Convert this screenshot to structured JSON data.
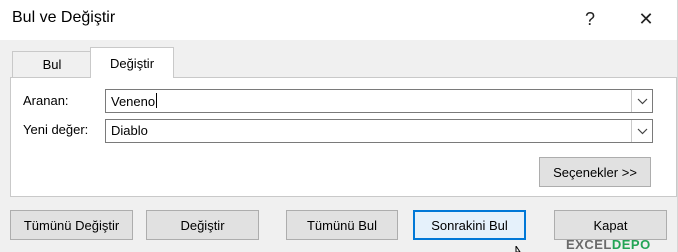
{
  "window": {
    "title": "Bul ve Değiştir",
    "help_glyph": "?",
    "close_glyph": "✕"
  },
  "tabs": [
    {
      "label": "Bul",
      "active": false
    },
    {
      "label": "Değiştir",
      "active": true
    }
  ],
  "form": {
    "find_label": "Aranan:",
    "find_value": "Veneno",
    "replace_label": "Yeni değer:",
    "replace_value": "Diablo",
    "options_label": "Seçenekler >>"
  },
  "buttons": {
    "replace_all": "Tümünü Değiştir",
    "replace": "Değiştir",
    "find_all": "Tümünü Bul",
    "find_next": "Sonrakini Bul",
    "close": "Kapat"
  },
  "watermark": {
    "part1": "EXCEL",
    "part2": "DEPO"
  },
  "colors": {
    "accent": "#0078d7",
    "button_face": "#e1e1e1",
    "dialog_bg": "#f0f0f0"
  },
  "icons": {
    "dropdown": "chevron-down-icon",
    "pointer": "mouse-pointer-icon"
  }
}
